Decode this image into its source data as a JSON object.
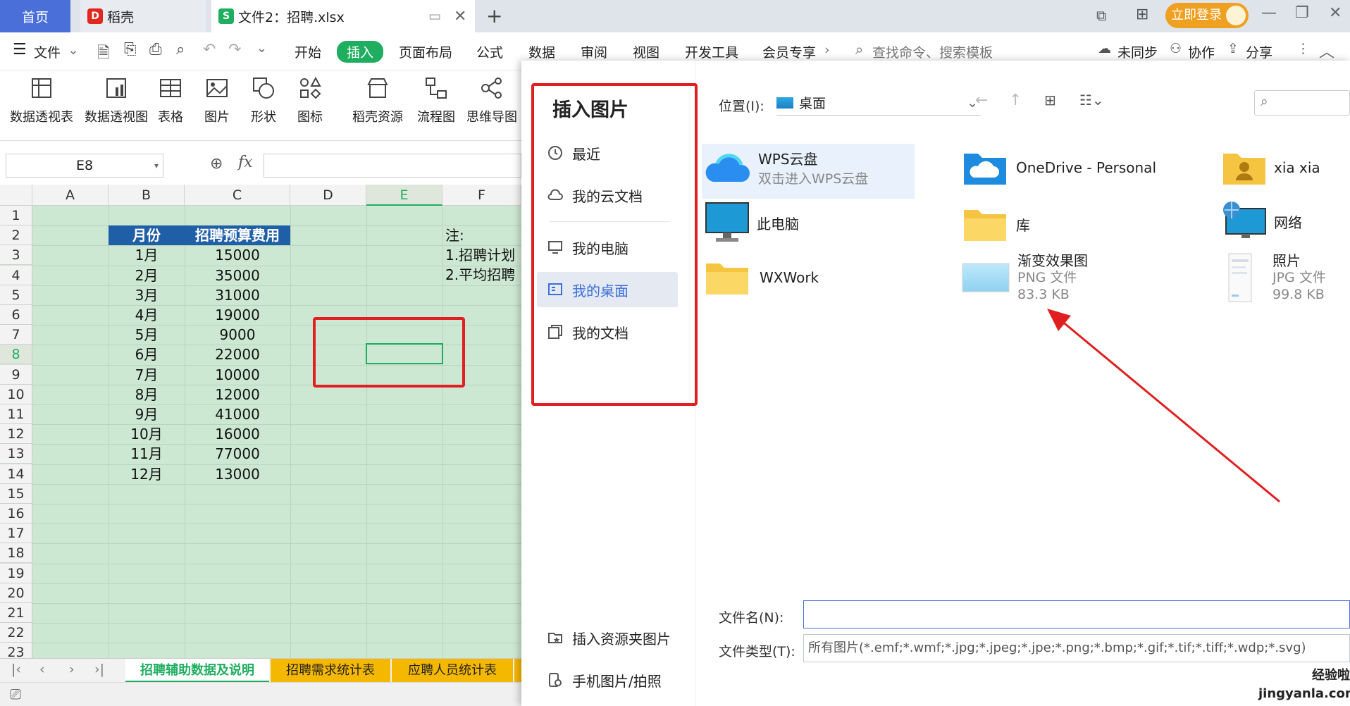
{
  "titlebar": {
    "tabs": [
      {
        "label": "首页"
      },
      {
        "label": "稻壳"
      },
      {
        "label": "文件2：招聘.xlsx"
      }
    ],
    "login_label": "立即登录"
  },
  "menubar": {
    "file_label": "文件",
    "items": [
      "开始",
      "插入",
      "页面布局",
      "公式",
      "数据",
      "审阅",
      "视图",
      "开发工具",
      "会员专享"
    ],
    "search_placeholder": "查找命令、搜索模板",
    "sync_label": "未同步",
    "collab_label": "协作",
    "share_label": "分享"
  },
  "ribbon": {
    "items": [
      "数据透视表",
      "数据透视图",
      "表格",
      "图片",
      "形状",
      "图标",
      "稻壳资源",
      "流程图",
      "思维导图"
    ]
  },
  "formula_bar": {
    "cell_ref": "E8",
    "fx": "fx"
  },
  "sheet": {
    "columns": [
      "A",
      "B",
      "C",
      "D",
      "E",
      "F"
    ],
    "rows": [
      "1",
      "2",
      "3",
      "4",
      "5",
      "6",
      "7",
      "8",
      "9",
      "10",
      "11",
      "12",
      "13",
      "14",
      "15",
      "16",
      "17",
      "18",
      "19",
      "20",
      "21",
      "22",
      "23"
    ],
    "table_headers": [
      "月份",
      "招聘预算费用"
    ],
    "table_rows": [
      [
        "1月",
        "15000"
      ],
      [
        "2月",
        "35000"
      ],
      [
        "3月",
        "31000"
      ],
      [
        "4月",
        "19000"
      ],
      [
        "5月",
        "9000"
      ],
      [
        "6月",
        "22000"
      ],
      [
        "7月",
        "10000"
      ],
      [
        "8月",
        "12000"
      ],
      [
        "9月",
        "41000"
      ],
      [
        "10月",
        "16000"
      ],
      [
        "11月",
        "77000"
      ],
      [
        "12月",
        "13000"
      ]
    ],
    "notes": [
      "注:",
      "1.招聘计划",
      "2.平均招聘"
    ],
    "accent_color": "#1f5fa8"
  },
  "sheet_tabs": [
    "招聘辅助数据及说明",
    "招聘需求统计表",
    "应聘人员统计表"
  ],
  "dialog": {
    "title": "插入图片",
    "sidebar": [
      "最近",
      "我的云文档",
      "我的电脑",
      "我的桌面",
      "我的文档"
    ],
    "sidebar_bottom": [
      "插入资源夹图片",
      "手机图片/拍照"
    ],
    "location_label": "位置(I):",
    "location_value": "桌面",
    "files": [
      {
        "name": "WPS云盘",
        "sub": "双击进入WPS云盘",
        "icon": "cloud-icon"
      },
      {
        "name": "OneDrive - Personal",
        "icon": "onedrive-folder-icon"
      },
      {
        "name": "xia xia",
        "icon": "user-folder-icon"
      },
      {
        "name": "此电脑",
        "icon": "computer-icon"
      },
      {
        "name": "库",
        "icon": "folder-icon"
      },
      {
        "name": "网络",
        "icon": "network-icon"
      },
      {
        "name": "WXWork",
        "icon": "folder-icon"
      },
      {
        "name": "渐变效果图",
        "type": "PNG 文件",
        "size": "83.3 KB",
        "icon": "image-icon"
      },
      {
        "name": "照片",
        "type": "JPG 文件",
        "size": "99.8 KB",
        "icon": "image-icon"
      }
    ],
    "filename_label": "文件名(N):",
    "filename_value": "",
    "filetype_label": "文件类型(T):",
    "filetype_value": "所有图片(*.emf;*.wmf;*.jpg;*.jpeg;*.jpe;*.png;*.bmp;*.gif;*.tif;*.tiff;*.wdp;*.svg)"
  },
  "watermark": "经验啦 jingyanla.com"
}
